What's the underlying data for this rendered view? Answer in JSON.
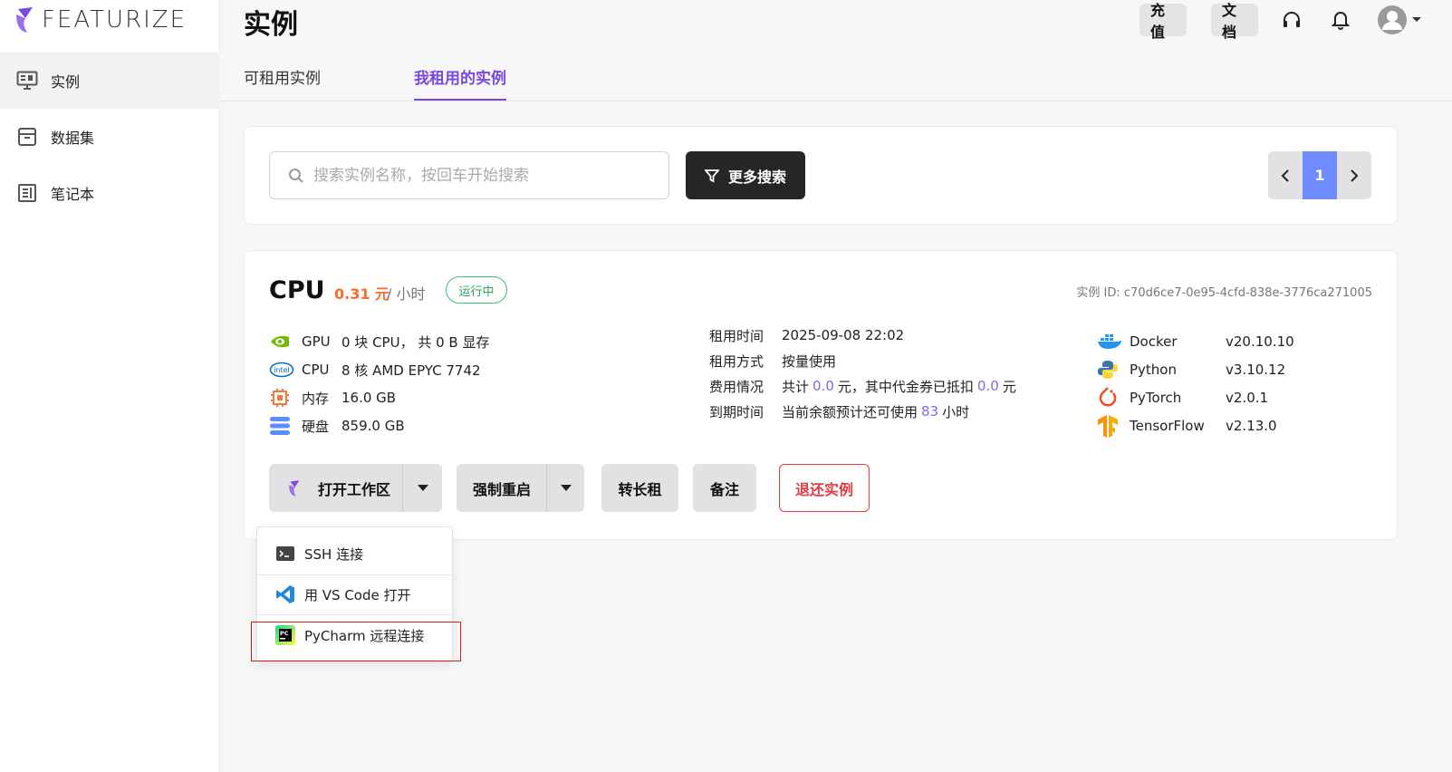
{
  "brand": {
    "name": "FEATURIZE"
  },
  "sidebar": {
    "items": [
      {
        "label": "实例",
        "icon": "monitor-icon"
      },
      {
        "label": "数据集",
        "icon": "archive-icon"
      },
      {
        "label": "笔记本",
        "icon": "notebook-icon"
      }
    ]
  },
  "header": {
    "title": "实例",
    "recharge_label": "充值",
    "docs_label": "文档"
  },
  "tabs": [
    {
      "label": "可租用实例"
    },
    {
      "label": "我租用的实例"
    }
  ],
  "search": {
    "placeholder": "搜索实例名称，按回车开始搜索",
    "more_label": "更多搜索",
    "page": "1"
  },
  "instance": {
    "type": "CPU",
    "price": "0.31 元",
    "price_unit": "/ 小时",
    "status": "运行中",
    "id_text": "实例 ID: c70d6ce7-0e95-4cfd-838e-3776ca271005",
    "hardware": [
      {
        "key": "GPU",
        "value": "0 块 CPU， 共 0 B 显存",
        "icon": "nvidia-icon"
      },
      {
        "key": "CPU",
        "value": "8 核 AMD EPYC 7742",
        "icon": "intel-icon"
      },
      {
        "key": "内存",
        "value": "16.0 GB",
        "icon": "chip-icon"
      },
      {
        "key": "硬盘",
        "value": "859.0 GB",
        "icon": "disk-icon"
      }
    ],
    "rental": {
      "time_key": "租用时间",
      "time_value": "2025-09-08 22:02",
      "mode_key": "租用方式",
      "mode_value": "按量使用",
      "cost_key": "费用情况",
      "cost_pre": "共计",
      "cost_total": "0.0",
      "cost_mid": "元，其中代金券已抵扣",
      "cost_voucher": "0.0",
      "cost_post": "元",
      "expire_key": "到期时间",
      "expire_pre": "当前余额预计还可使用",
      "expire_hours": "83",
      "expire_post": "小时"
    },
    "software": [
      {
        "name": "Docker",
        "version": "v20.10.10",
        "icon": "docker-icon"
      },
      {
        "name": "Python",
        "version": "v3.10.12",
        "icon": "python-icon"
      },
      {
        "name": "PyTorch",
        "version": "v2.0.1",
        "icon": "pytorch-icon"
      },
      {
        "name": "TensorFlow",
        "version": "v2.13.0",
        "icon": "tensorflow-icon"
      }
    ],
    "actions": {
      "open_workspace": "打开工作区",
      "force_restart": "强制重启",
      "long_term": "转长租",
      "remark": "备注",
      "return": "退还实例"
    }
  },
  "dropdown": {
    "items": [
      {
        "label": "SSH 连接",
        "icon": "terminal-icon"
      },
      {
        "label": "用 VS Code 打开",
        "icon": "vscode-icon"
      },
      {
        "label": "PyCharm 远程连接",
        "icon": "pycharm-icon"
      }
    ]
  },
  "colors": {
    "accent": "#7b46e6",
    "price": "#ff6a2a",
    "status": "#2aa462",
    "danger": "#e23b45",
    "pager": "#6e8cff"
  }
}
